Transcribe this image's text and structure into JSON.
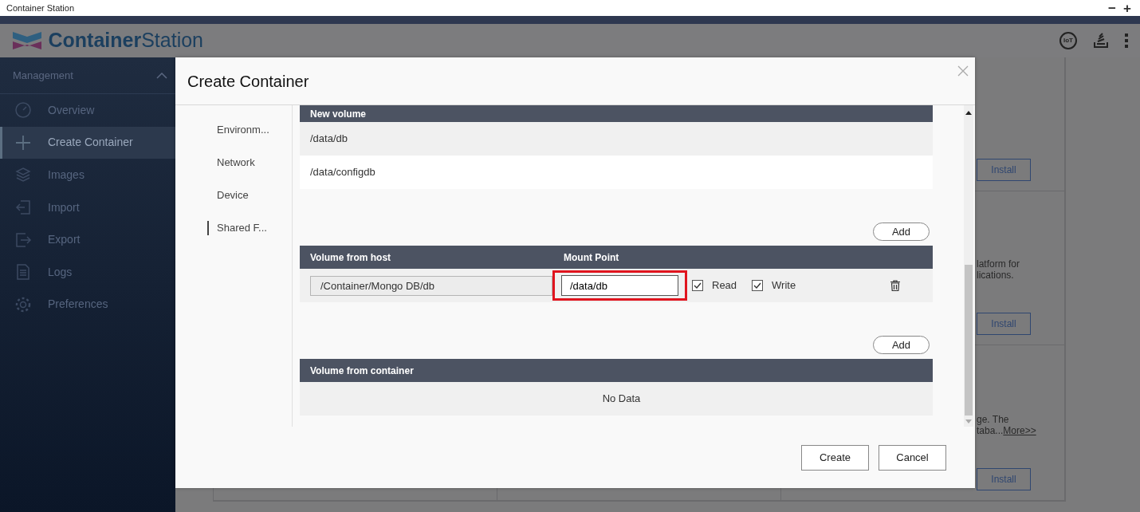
{
  "window": {
    "title": "Container Station",
    "controls": [
      "−",
      "+"
    ]
  },
  "header": {
    "logo_bold": "Container",
    "logo_light": "Station",
    "iot_label": "IoT"
  },
  "sidebar": {
    "section": "Management",
    "expanded": true,
    "items": [
      {
        "label": "Overview",
        "selected": false
      },
      {
        "label": "Create Container",
        "selected": true
      },
      {
        "label": "Images",
        "selected": false
      },
      {
        "label": "Import",
        "selected": false
      },
      {
        "label": "Export",
        "selected": false
      },
      {
        "label": "Logs",
        "selected": false
      },
      {
        "label": "Preferences",
        "selected": false
      }
    ]
  },
  "background_cards": [
    {
      "button": "Install"
    },
    {
      "lines": [
        "latform for",
        "lications."
      ],
      "button": "Install"
    },
    {
      "lines": [
        "ge. The",
        "taba..."
      ],
      "more_link": "More>>",
      "button": "Install"
    }
  ],
  "dialog": {
    "title": "Create Container",
    "steps": [
      {
        "label": "Environm...",
        "selected": false
      },
      {
        "label": "Network",
        "selected": false
      },
      {
        "label": "Device",
        "selected": false
      },
      {
        "label": "Shared F...",
        "selected": true
      }
    ],
    "new_volume": {
      "heading": "New volume",
      "rows": [
        "/data/db",
        "/data/configdb"
      ]
    },
    "host_add_button": "Add",
    "host_volumes": {
      "columns": [
        "Volume from host",
        "Mount Point"
      ],
      "rows": [
        {
          "host": "/Container/Mongo DB/db",
          "mount": "/data/db",
          "highlighted": true,
          "read": true,
          "read_label": "Read",
          "write": true,
          "write_label": "Write"
        }
      ]
    },
    "container_add_button": "Add",
    "container_volumes": {
      "heading": "Volume from container",
      "empty": "No Data"
    },
    "buttons": [
      "Create",
      "Cancel"
    ]
  }
}
